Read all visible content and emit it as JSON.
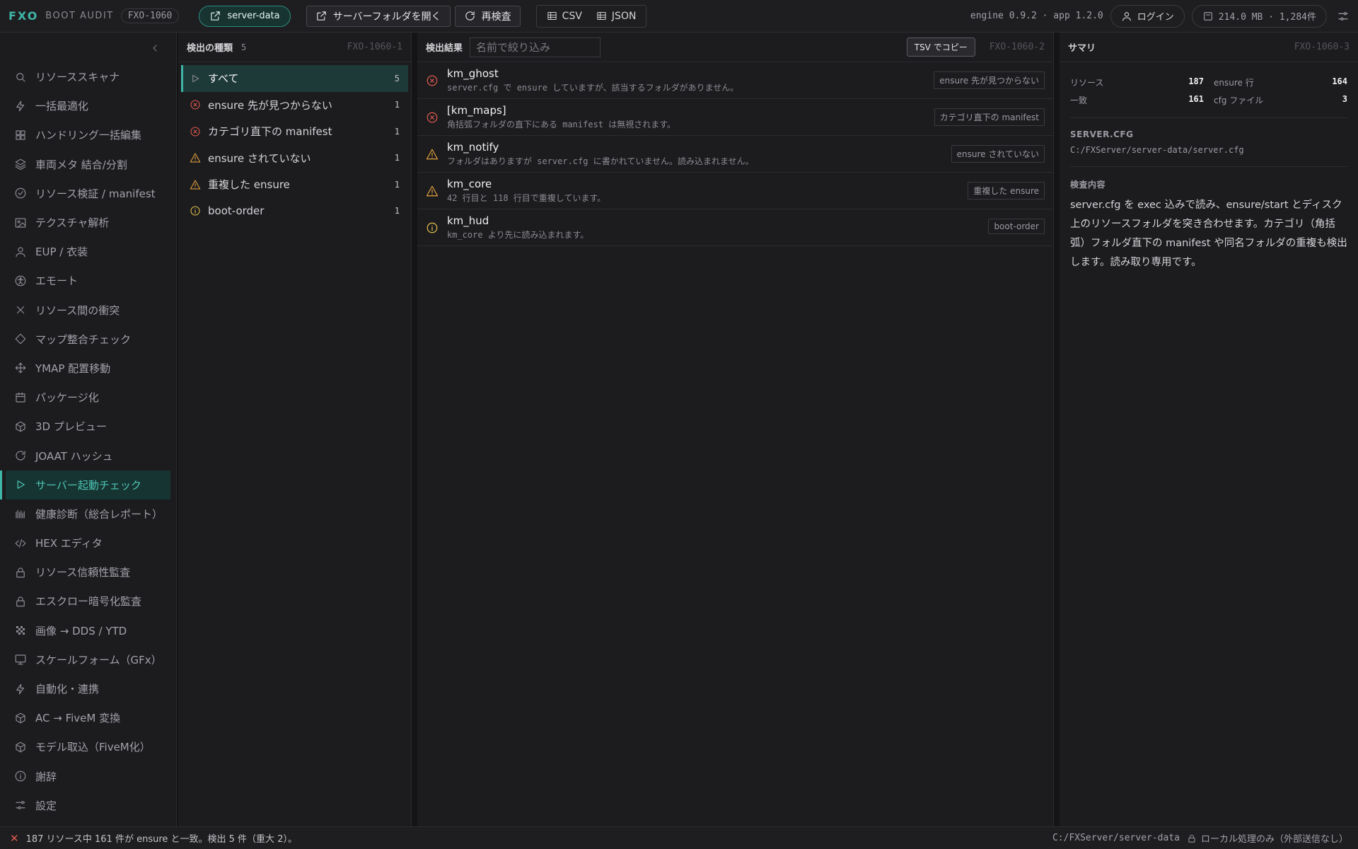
{
  "topbar": {
    "brand": "FXO",
    "brand_sub": "BOOT AUDIT",
    "code": "FXO-1060",
    "path_pill": "server-data",
    "open_folder": "サーバーフォルダを開く",
    "recheck": "再検査",
    "csv": "CSV",
    "json": "JSON",
    "engine": "engine 0.9.2 · app 1.2.0",
    "login": "ログイン",
    "storage": "214.0 MB · 1,284件"
  },
  "sidebar": {
    "items": [
      {
        "label": "リソーススキャナ",
        "icon": "search-icon"
      },
      {
        "label": "一括最適化",
        "icon": "bolt-icon"
      },
      {
        "label": "ハンドリング一括編集",
        "icon": "grid-icon"
      },
      {
        "label": "車両メタ 結合/分割",
        "icon": "layers-icon"
      },
      {
        "label": "リソース検証 / manifest",
        "icon": "check-circle-icon"
      },
      {
        "label": "テクスチャ解析",
        "icon": "image-icon"
      },
      {
        "label": "EUP / 衣装",
        "icon": "user-icon"
      },
      {
        "label": "エモート",
        "icon": "accessibility-icon"
      },
      {
        "label": "リソース間の衝突",
        "icon": "x-icon"
      },
      {
        "label": "マップ整合チェック",
        "icon": "diamond-icon"
      },
      {
        "label": "YMAP 配置移動",
        "icon": "move-icon"
      },
      {
        "label": "パッケージ化",
        "icon": "calendar-icon"
      },
      {
        "label": "3D プレビュー",
        "icon": "cube-icon"
      },
      {
        "label": "JOAAT ハッシュ",
        "icon": "refresh-icon"
      },
      {
        "label": "サーバー起動チェック",
        "icon": "play-icon"
      },
      {
        "label": "健康診断（総合レポート）",
        "icon": "bars-icon"
      },
      {
        "label": "HEX エディタ",
        "icon": "code-icon"
      },
      {
        "label": "リソース信頼性監査",
        "icon": "lock-icon"
      },
      {
        "label": "エスクロー暗号化監査",
        "icon": "lock-icon"
      },
      {
        "label": "画像 → DDS / YTD",
        "icon": "checker-icon"
      },
      {
        "label": "スケールフォーム（GFx）",
        "icon": "monitor-icon"
      },
      {
        "label": "自動化・連携",
        "icon": "bolt-icon"
      },
      {
        "label": "AC → FiveM 変換",
        "icon": "cube-icon"
      },
      {
        "label": "モデル取込（FiveM化）",
        "icon": "cube-icon"
      },
      {
        "label": "謝辞",
        "icon": "info-icon"
      },
      {
        "label": "設定",
        "icon": "sliders-icon"
      }
    ],
    "active_index": 14
  },
  "types_panel": {
    "title": "検出の種類",
    "count": "5",
    "id": "FXO-1060-1",
    "items": [
      {
        "label": "すべて",
        "count": "5",
        "icon": "play-icon",
        "kind": "play"
      },
      {
        "label": "ensure 先が見つからない",
        "count": "1",
        "icon": "error-circle-icon",
        "kind": "err"
      },
      {
        "label": "カテゴリ直下の manifest",
        "count": "1",
        "icon": "error-circle-icon",
        "kind": "err"
      },
      {
        "label": "ensure されていない",
        "count": "1",
        "icon": "warning-icon",
        "kind": "warn"
      },
      {
        "label": "重複した ensure",
        "count": "1",
        "icon": "warning-icon",
        "kind": "warn"
      },
      {
        "label": "boot-order",
        "count": "1",
        "icon": "info-icon",
        "kind": "info"
      }
    ]
  },
  "results_panel": {
    "title": "検出結果",
    "filter_placeholder": "名前で絞り込み",
    "tsv": "TSV でコピー",
    "id": "FXO-1060-2",
    "items": [
      {
        "name": "km_ghost",
        "desc": "server.cfg で ensure していますが、該当するフォルダがありません。",
        "tag": "ensure 先が見つからない",
        "kind": "err",
        "icon": "error-circle-icon"
      },
      {
        "name": "[km_maps]",
        "desc": "角括弧フォルダの直下にある manifest は無視されます。",
        "tag": "カテゴリ直下の manifest",
        "kind": "err",
        "icon": "error-circle-icon"
      },
      {
        "name": "km_notify",
        "desc": "フォルダはありますが server.cfg に書かれていません。読み込まれません。",
        "tag": "ensure されていない",
        "kind": "warn",
        "icon": "warning-icon"
      },
      {
        "name": "km_core",
        "desc": "42 行目と 118 行目で重複しています。",
        "tag": "重複した ensure",
        "kind": "warn",
        "icon": "warning-icon"
      },
      {
        "name": "km_hud",
        "desc": "km_core より先に読み込まれます。",
        "tag": "boot-order",
        "kind": "info",
        "icon": "info-icon"
      }
    ]
  },
  "summary_panel": {
    "title": "サマリ",
    "id": "FXO-1060-3",
    "stats": [
      {
        "label": "リソース",
        "value": "187"
      },
      {
        "label": "ensure 行",
        "value": "164"
      },
      {
        "label": "一致",
        "value": "161"
      },
      {
        "label": "cfg ファイル",
        "value": "3"
      }
    ],
    "cfg_label": "SERVER.CFG",
    "cfg_path": "C:/FXServer/server-data/server.cfg",
    "desc_label": "検査内容",
    "desc": "server.cfg を exec 込みで読み、ensure/start とディスク上のリソースフォルダを突き合わせます。カテゴリ（角括弧）フォルダ直下の manifest や同名フォルダの重複も検出します。読み取り専用です。"
  },
  "statusbar": {
    "message": "187 リソース中 161 件が ensure と一致。検出 5 件（重大 2）。",
    "path": "C:/FXServer/server-data",
    "local": "ローカル処理のみ（外部送信なし）"
  }
}
